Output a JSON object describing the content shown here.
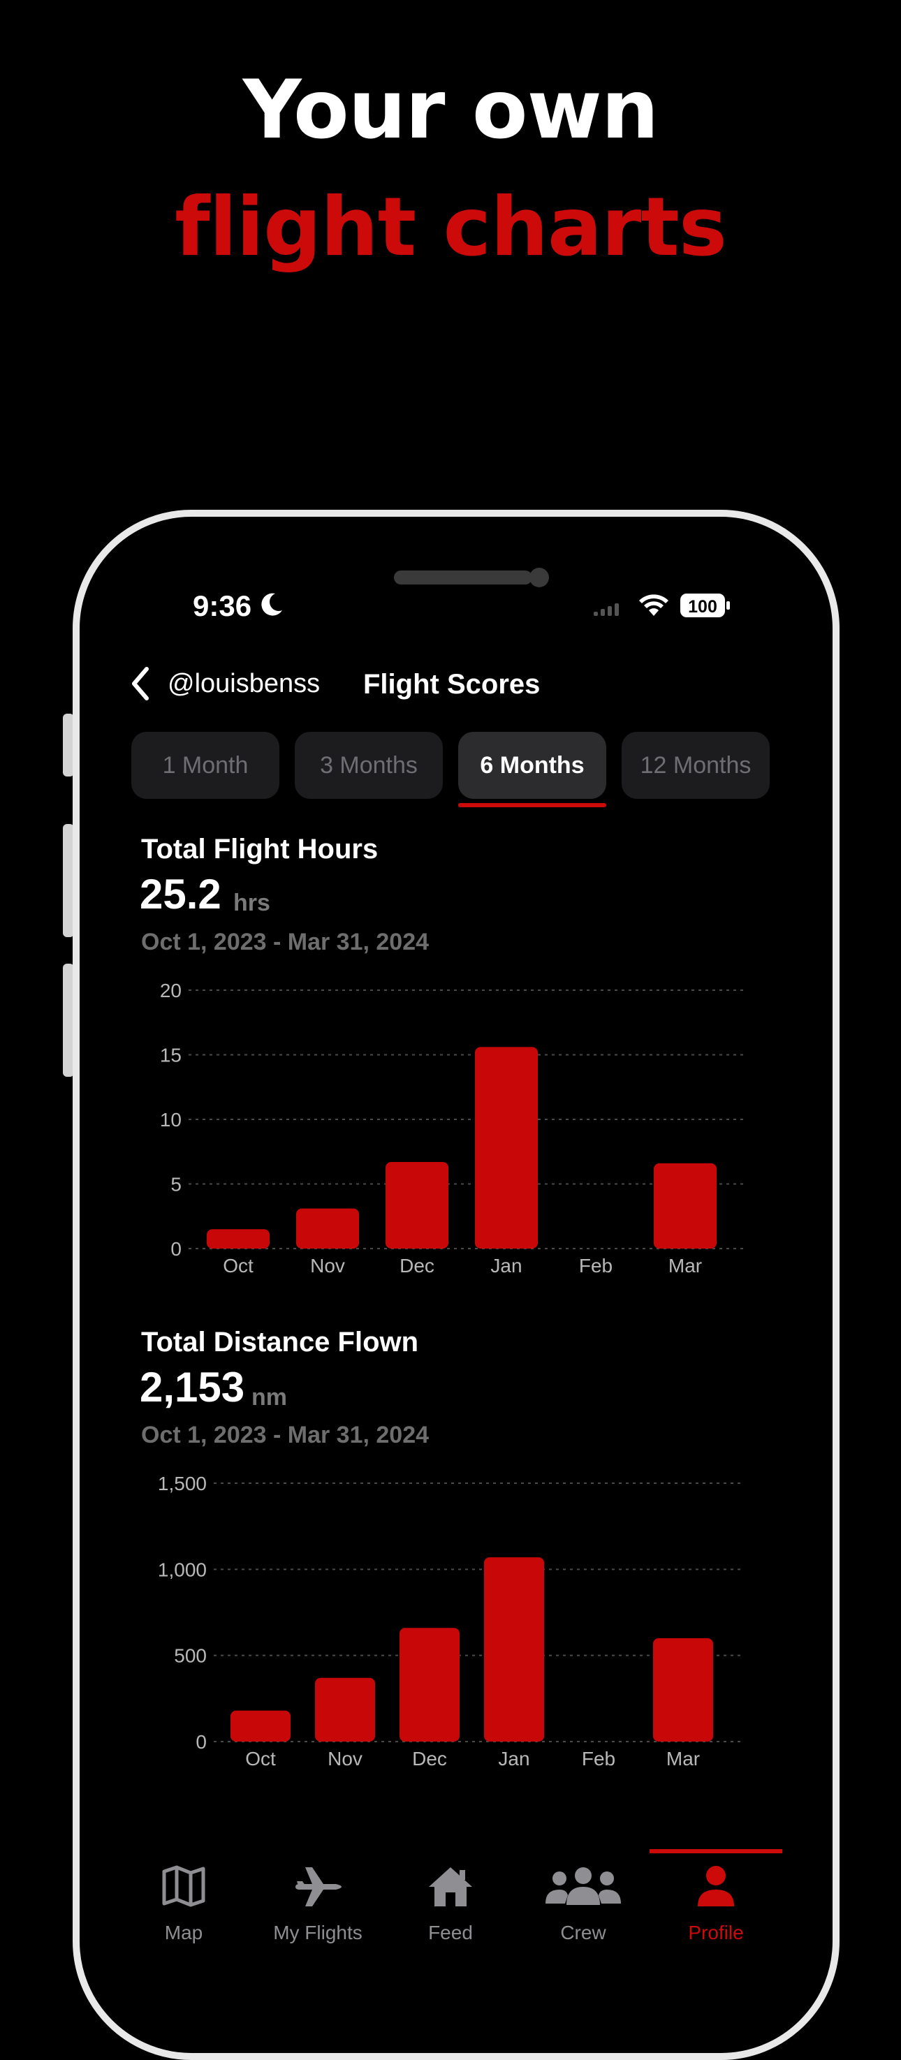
{
  "promo": {
    "line1": "Your own",
    "line2": "flight charts",
    "accent_color": "#cc0a0a"
  },
  "status_bar": {
    "time": "9:36",
    "battery": "100",
    "icons": [
      "moon-icon",
      "cellular-signal-icon",
      "wifi-icon",
      "battery-icon"
    ]
  },
  "nav": {
    "back_icon": "chevron-left-icon",
    "handle": "@louisbenss",
    "title": "Flight Scores"
  },
  "segments": {
    "options": [
      "1 Month",
      "3 Months",
      "6 Months",
      "12 Months"
    ],
    "selected": "6 Months"
  },
  "hours_section": {
    "title": "Total Flight Hours",
    "value": "25.2",
    "unit": "hrs",
    "range": "Oct 1, 2023 - Mar 31, 2024"
  },
  "distance_section": {
    "title": "Total Distance Flown",
    "value": "2,153",
    "unit": "nm",
    "range": "Oct 1, 2023 - Mar 31, 2024"
  },
  "chart_data": [
    {
      "type": "bar",
      "title": "Total Flight Hours",
      "categories": [
        "Oct",
        "Nov",
        "Dec",
        "Jan",
        "Feb",
        "Mar"
      ],
      "values": [
        1.5,
        3.1,
        6.7,
        15.6,
        0,
        6.6
      ],
      "ylim": [
        0,
        20
      ],
      "yticks": [
        0,
        5,
        10,
        15,
        20
      ],
      "ytick_labels": [
        "0",
        "5",
        "10",
        "15",
        "20"
      ],
      "grid": true,
      "bar_color": "#c80808"
    },
    {
      "type": "bar",
      "title": "Total Distance Flown",
      "categories": [
        "Oct",
        "Nov",
        "Dec",
        "Jan",
        "Feb",
        "Mar"
      ],
      "values": [
        180,
        370,
        660,
        1070,
        0,
        600
      ],
      "ylim": [
        0,
        1500
      ],
      "yticks": [
        0,
        500,
        1000,
        1500
      ],
      "ytick_labels": [
        "0",
        "500",
        "1,000",
        "1,500"
      ],
      "grid": true,
      "bar_color": "#c80808"
    }
  ],
  "tabbar": {
    "tabs": [
      {
        "label": "Map",
        "icon": "map-icon"
      },
      {
        "label": "My Flights",
        "icon": "airplane-icon"
      },
      {
        "label": "Feed",
        "icon": "home-icon"
      },
      {
        "label": "Crew",
        "icon": "people-icon"
      },
      {
        "label": "Profile",
        "icon": "person-icon"
      }
    ],
    "active": "Profile"
  }
}
